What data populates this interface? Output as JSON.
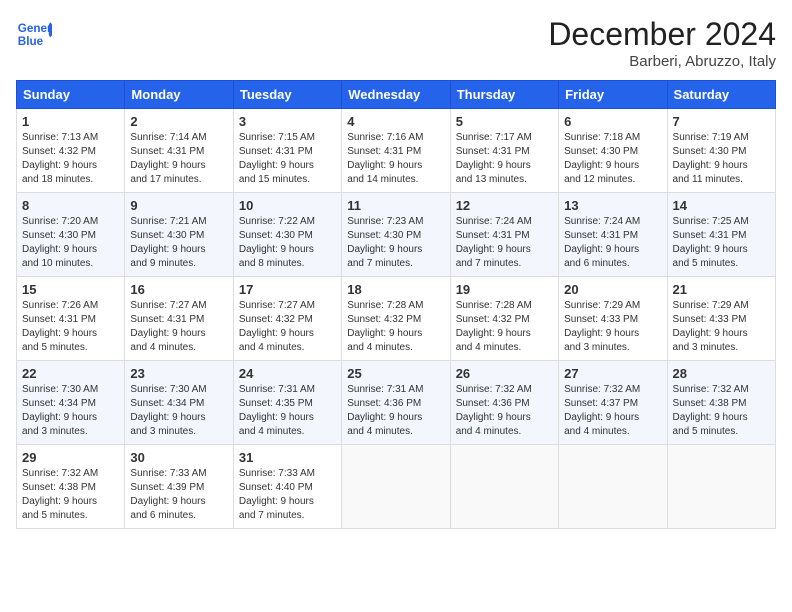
{
  "logo": {
    "line1": "General",
    "line2": "Blue"
  },
  "title": "December 2024",
  "location": "Barberi, Abruzzo, Italy",
  "days_of_week": [
    "Sunday",
    "Monday",
    "Tuesday",
    "Wednesday",
    "Thursday",
    "Friday",
    "Saturday"
  ],
  "weeks": [
    [
      {
        "day": "1",
        "info": "Sunrise: 7:13 AM\nSunset: 4:32 PM\nDaylight: 9 hours\nand 18 minutes."
      },
      {
        "day": "2",
        "info": "Sunrise: 7:14 AM\nSunset: 4:31 PM\nDaylight: 9 hours\nand 17 minutes."
      },
      {
        "day": "3",
        "info": "Sunrise: 7:15 AM\nSunset: 4:31 PM\nDaylight: 9 hours\nand 15 minutes."
      },
      {
        "day": "4",
        "info": "Sunrise: 7:16 AM\nSunset: 4:31 PM\nDaylight: 9 hours\nand 14 minutes."
      },
      {
        "day": "5",
        "info": "Sunrise: 7:17 AM\nSunset: 4:31 PM\nDaylight: 9 hours\nand 13 minutes."
      },
      {
        "day": "6",
        "info": "Sunrise: 7:18 AM\nSunset: 4:30 PM\nDaylight: 9 hours\nand 12 minutes."
      },
      {
        "day": "7",
        "info": "Sunrise: 7:19 AM\nSunset: 4:30 PM\nDaylight: 9 hours\nand 11 minutes."
      }
    ],
    [
      {
        "day": "8",
        "info": "Sunrise: 7:20 AM\nSunset: 4:30 PM\nDaylight: 9 hours\nand 10 minutes."
      },
      {
        "day": "9",
        "info": "Sunrise: 7:21 AM\nSunset: 4:30 PM\nDaylight: 9 hours\nand 9 minutes."
      },
      {
        "day": "10",
        "info": "Sunrise: 7:22 AM\nSunset: 4:30 PM\nDaylight: 9 hours\nand 8 minutes."
      },
      {
        "day": "11",
        "info": "Sunrise: 7:23 AM\nSunset: 4:30 PM\nDaylight: 9 hours\nand 7 minutes."
      },
      {
        "day": "12",
        "info": "Sunrise: 7:24 AM\nSunset: 4:31 PM\nDaylight: 9 hours\nand 7 minutes."
      },
      {
        "day": "13",
        "info": "Sunrise: 7:24 AM\nSunset: 4:31 PM\nDaylight: 9 hours\nand 6 minutes."
      },
      {
        "day": "14",
        "info": "Sunrise: 7:25 AM\nSunset: 4:31 PM\nDaylight: 9 hours\nand 5 minutes."
      }
    ],
    [
      {
        "day": "15",
        "info": "Sunrise: 7:26 AM\nSunset: 4:31 PM\nDaylight: 9 hours\nand 5 minutes."
      },
      {
        "day": "16",
        "info": "Sunrise: 7:27 AM\nSunset: 4:31 PM\nDaylight: 9 hours\nand 4 minutes."
      },
      {
        "day": "17",
        "info": "Sunrise: 7:27 AM\nSunset: 4:32 PM\nDaylight: 9 hours\nand 4 minutes."
      },
      {
        "day": "18",
        "info": "Sunrise: 7:28 AM\nSunset: 4:32 PM\nDaylight: 9 hours\nand 4 minutes."
      },
      {
        "day": "19",
        "info": "Sunrise: 7:28 AM\nSunset: 4:32 PM\nDaylight: 9 hours\nand 4 minutes."
      },
      {
        "day": "20",
        "info": "Sunrise: 7:29 AM\nSunset: 4:33 PM\nDaylight: 9 hours\nand 3 minutes."
      },
      {
        "day": "21",
        "info": "Sunrise: 7:29 AM\nSunset: 4:33 PM\nDaylight: 9 hours\nand 3 minutes."
      }
    ],
    [
      {
        "day": "22",
        "info": "Sunrise: 7:30 AM\nSunset: 4:34 PM\nDaylight: 9 hours\nand 3 minutes."
      },
      {
        "day": "23",
        "info": "Sunrise: 7:30 AM\nSunset: 4:34 PM\nDaylight: 9 hours\nand 3 minutes."
      },
      {
        "day": "24",
        "info": "Sunrise: 7:31 AM\nSunset: 4:35 PM\nDaylight: 9 hours\nand 4 minutes."
      },
      {
        "day": "25",
        "info": "Sunrise: 7:31 AM\nSunset: 4:36 PM\nDaylight: 9 hours\nand 4 minutes."
      },
      {
        "day": "26",
        "info": "Sunrise: 7:32 AM\nSunset: 4:36 PM\nDaylight: 9 hours\nand 4 minutes."
      },
      {
        "day": "27",
        "info": "Sunrise: 7:32 AM\nSunset: 4:37 PM\nDaylight: 9 hours\nand 4 minutes."
      },
      {
        "day": "28",
        "info": "Sunrise: 7:32 AM\nSunset: 4:38 PM\nDaylight: 9 hours\nand 5 minutes."
      }
    ],
    [
      {
        "day": "29",
        "info": "Sunrise: 7:32 AM\nSunset: 4:38 PM\nDaylight: 9 hours\nand 5 minutes."
      },
      {
        "day": "30",
        "info": "Sunrise: 7:33 AM\nSunset: 4:39 PM\nDaylight: 9 hours\nand 6 minutes."
      },
      {
        "day": "31",
        "info": "Sunrise: 7:33 AM\nSunset: 4:40 PM\nDaylight: 9 hours\nand 7 minutes."
      },
      null,
      null,
      null,
      null
    ]
  ]
}
